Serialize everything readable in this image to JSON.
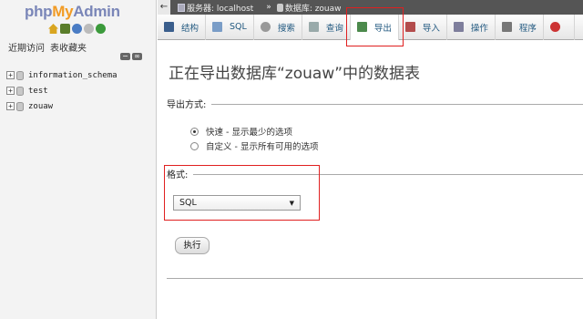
{
  "sidebar": {
    "logo": {
      "php": "php",
      "my": "My",
      "admin": "Admin"
    },
    "tabs": [
      "近期访问",
      "表收藏夹"
    ],
    "databases": [
      {
        "name": "information_schema"
      },
      {
        "name": "test"
      },
      {
        "name": "zouaw"
      }
    ]
  },
  "breadcrumb": {
    "back": "←",
    "server": "服务器: localhost",
    "separator": "»",
    "database": "数据库: zouaw"
  },
  "tabs": [
    {
      "label": "结构",
      "icon": "structure-icon"
    },
    {
      "label": "SQL",
      "icon": "sql-icon"
    },
    {
      "label": "搜索",
      "icon": "search-icon"
    },
    {
      "label": "查询",
      "icon": "query-icon"
    },
    {
      "label": "导出",
      "icon": "export-icon",
      "active": true
    },
    {
      "label": "导入",
      "icon": "import-icon"
    },
    {
      "label": "操作",
      "icon": "operations-icon"
    },
    {
      "label": "程序",
      "icon": "routines-icon"
    },
    {
      "label": "",
      "icon": "events-icon"
    }
  ],
  "main": {
    "title": "正在导出数据库“zouaw”中的数据表",
    "export_method": {
      "legend": "导出方式:",
      "options": [
        {
          "label": "快速 - 显示最少的选项",
          "checked": true
        },
        {
          "label": "自定义 - 显示所有可用的选项",
          "checked": false
        }
      ]
    },
    "format": {
      "legend": "格式:",
      "selected": "SQL"
    },
    "go_label": "执行"
  },
  "colors": {
    "highlight": "#e02020",
    "link": "#235a81",
    "crumb_bg": "#555555"
  }
}
